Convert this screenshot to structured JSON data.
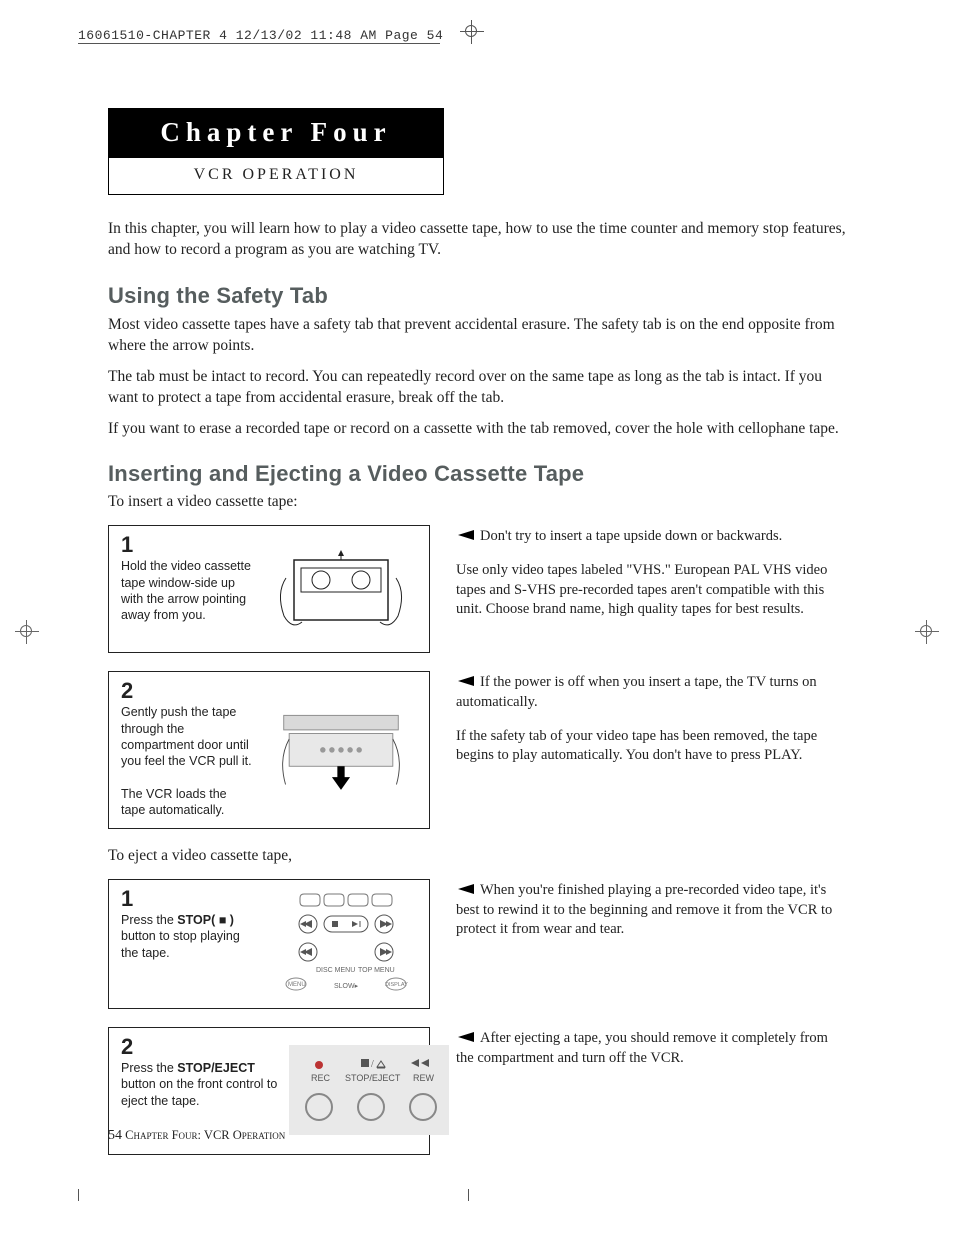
{
  "slug": "16061510-CHAPTER 4  12/13/02 11:48 AM  Page 54",
  "chapter_banner": {
    "title": "Chapter Four",
    "subtitle": "VCR OPERATION"
  },
  "intro": "In this chapter, you will learn how to play a video cassette tape, how to use the time counter and memory stop features, and how to record a program as you are watching TV.",
  "section1": {
    "heading": "Using the Safety Tab",
    "p1": "Most video cassette tapes have a safety tab that prevent accidental erasure. The safety tab is on the end opposite from where the arrow points.",
    "p2": "The tab must be intact to record. You can repeatedly record over on the same tape as long as the tab is intact. If you want to protect a tape from accidental erasure, break off the tab.",
    "p3": "If you want to erase a recorded tape or record on a cassette with the tab removed, cover the hole with cellophane tape."
  },
  "section2": {
    "heading": "Inserting and Ejecting a Video Cassette Tape",
    "insert_lede": "To insert a video cassette tape:",
    "step1": {
      "num": "1",
      "text": "Hold the video cassette tape window-side up with the arrow pointing away from you."
    },
    "side1": {
      "a": "Don't try to insert a tape upside down or backwards.",
      "b": "Use only video tapes labeled \"VHS.\" European PAL VHS video tapes and S-VHS pre-recorded tapes aren't compatible with this unit. Choose brand name, high quality tapes for best results."
    },
    "step2": {
      "num": "2",
      "text_a": "Gently push the tape through the compartment door until you feel the VCR pull it.",
      "text_b": "The VCR loads the tape automatically."
    },
    "side2": {
      "a": "If the power is off when you insert a tape, the TV turns on automatically.",
      "b": "If the safety tab of your video tape has been removed, the tape begins to play automatically. You don't have to press PLAY."
    },
    "eject_lede": "To eject a video cassette tape,",
    "eject1": {
      "num": "1",
      "pre": "Press the ",
      "bold": "STOP( ■ )",
      "post": " button to stop playing the tape."
    },
    "eject_side1": {
      "a": "When you're finished playing a pre-recorded video tape, it's best to rewind it to the beginning and remove it from the VCR to protect it from wear and tear."
    },
    "eject2": {
      "num": "2",
      "pre": "Press the ",
      "bold": "STOP/EJECT",
      "post": " button on the front control to eject the tape."
    },
    "eject_side2": {
      "a": "After ejecting a tape, you should remove it completely from the compartment and turn off the VCR."
    },
    "front_labels": {
      "rec": "REC",
      "stopeject": "STOP/EJECT",
      "rew": "REW"
    }
  },
  "footer": {
    "page_num": "54",
    "text": " Chapter Four: VCR Operation"
  }
}
